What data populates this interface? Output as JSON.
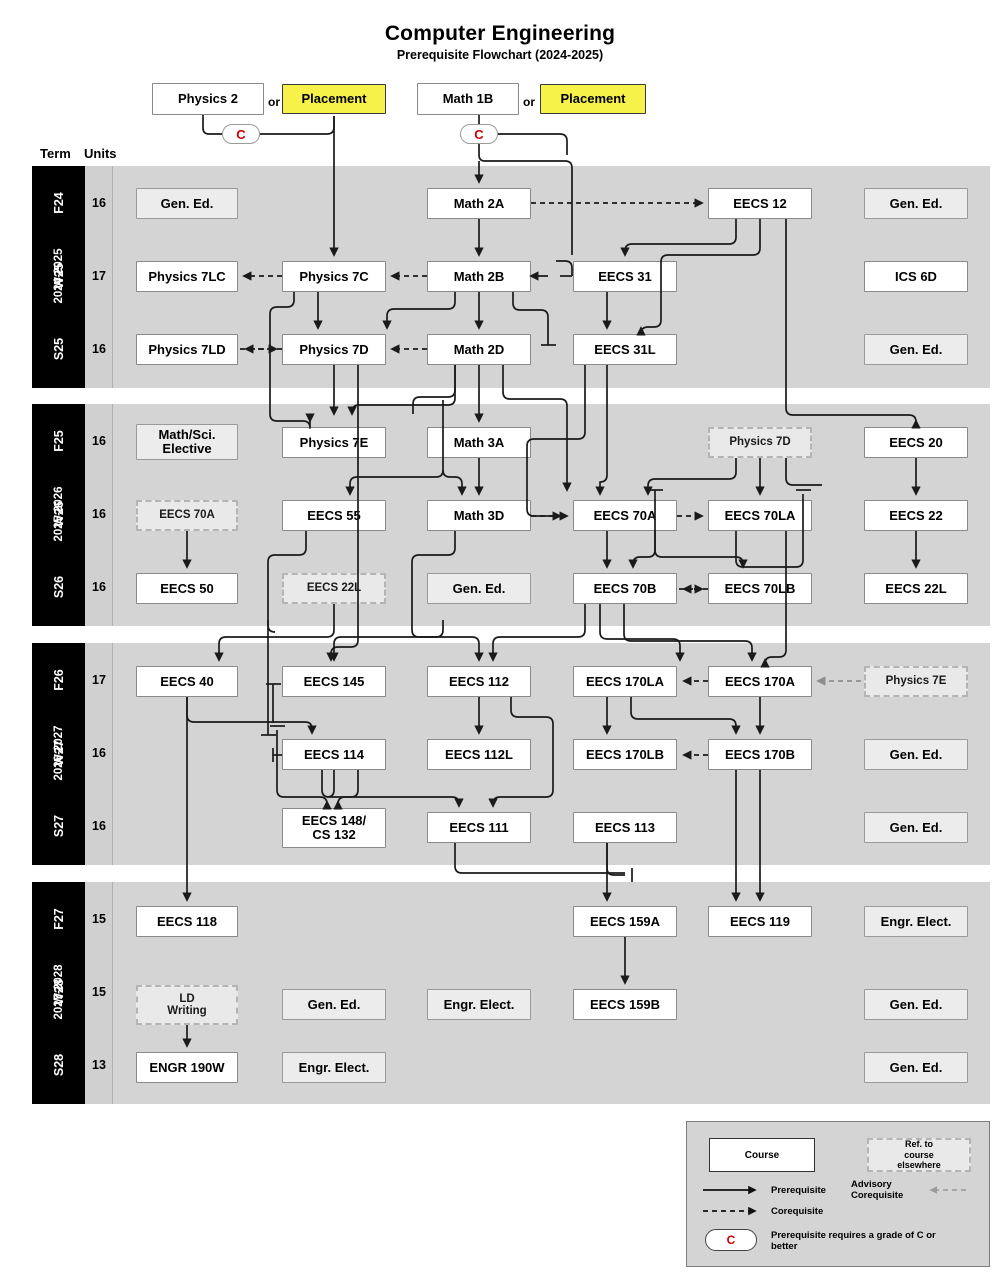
{
  "header": {
    "title": "Computer Engineering",
    "subtitle": "Prerequisite Flowchart (2024-2025)",
    "term_label": "Term",
    "units_label": "Units"
  },
  "entry_row": {
    "physics_2": "Physics 2",
    "or_1": "or",
    "placement_1": "Placement",
    "math_1b": "Math 1B",
    "or_2": "or",
    "placement_2": "Placement",
    "grade_badge_1": "C",
    "grade_badge_2": "C"
  },
  "years": [
    {
      "year_label": "2024-2025",
      "terms": [
        {
          "term": "F24",
          "units": "16",
          "courses": [
            "Gen. Ed.",
            "",
            "Math 2A",
            "",
            "EECS 12",
            "Gen. Ed."
          ]
        },
        {
          "term": "W25",
          "units": "17",
          "courses": [
            "Physics 7LC",
            "Physics 7C",
            "Math 2B",
            "EECS 31",
            "",
            "ICS 6D"
          ]
        },
        {
          "term": "S25",
          "units": "16",
          "courses": [
            "Physics 7LD",
            "Physics 7D",
            "Math 2D",
            "EECS 31L",
            "",
            "Gen. Ed."
          ]
        }
      ]
    },
    {
      "year_label": "2025-2026",
      "terms": [
        {
          "term": "F25",
          "units": "16",
          "courses": [
            "Math/Sci. Elective",
            "Physics 7E",
            "Math 3A",
            "",
            "Physics 7D",
            "EECS 20"
          ]
        },
        {
          "term": "W26",
          "units": "16",
          "courses": [
            "EECS 70A",
            "EECS 55",
            "Math 3D",
            "EECS 70A",
            "EECS 70LA",
            "EECS 22"
          ]
        },
        {
          "term": "S26",
          "units": "16",
          "courses": [
            "EECS 50",
            "EECS 22L",
            "Gen. Ed.",
            "EECS 70B",
            "EECS 70LB",
            "EECS 22L"
          ]
        }
      ]
    },
    {
      "year_label": "2026-2027",
      "terms": [
        {
          "term": "F26",
          "units": "17",
          "courses": [
            "EECS 40",
            "EECS 145",
            "EECS 112",
            "EECS 170LA",
            "EECS 170A",
            "Physics 7E"
          ]
        },
        {
          "term": "W27",
          "units": "16",
          "courses": [
            "",
            "EECS 114",
            "EECS 112L",
            "EECS 170LB",
            "EECS 170B",
            "Gen. Ed."
          ]
        },
        {
          "term": "S27",
          "units": "16",
          "courses": [
            "",
            "EECS 148/ CS 132",
            "EECS 111",
            "EECS 113",
            "",
            "Gen. Ed."
          ]
        }
      ]
    },
    {
      "year_label": "2027-2028",
      "terms": [
        {
          "term": "F27",
          "units": "15",
          "courses": [
            "EECS 118",
            "",
            "",
            "EECS 159A",
            "EECS 119",
            "Engr. Elect."
          ]
        },
        {
          "term": "W28",
          "units": "15",
          "courses": [
            "LD Writing",
            "Gen. Ed.",
            "Engr. Elect.",
            "EECS 159B",
            "",
            "Gen. Ed."
          ]
        },
        {
          "term": "S28",
          "units": "13",
          "courses": [
            "ENGR 190W",
            "Engr. Elect.",
            "",
            "",
            "",
            "Gen. Ed."
          ]
        }
      ]
    }
  ],
  "boxes": {
    "y1": {
      "c_r1_gened": "Gen. Ed.",
      "c_r1_math2a": "Math 2A",
      "c_r1_eecs12": "EECS 12",
      "c_r1_gened2": "Gen. Ed.",
      "c_r2_phys7lc": "Physics 7LC",
      "c_r2_phys7c": "Physics 7C",
      "c_r2_math2b": "Math 2B",
      "c_r2_eecs31": "EECS 31",
      "c_r2_ics6d": "ICS 6D",
      "c_r3_phys7ld": "Physics 7LD",
      "c_r3_phys7d": "Physics 7D",
      "c_r3_math2d": "Math 2D",
      "c_r3_eecs31l": "EECS 31L",
      "c_r3_gened": "Gen. Ed."
    },
    "y2": {
      "c_r1_mathsci_l1": "Math/Sci.",
      "c_r1_mathsci_l2": "Elective",
      "c_r1_phys7e": "Physics 7E",
      "c_r1_math3a": "Math 3A",
      "c_r1_phys7d_ref": "Physics 7D",
      "c_r1_eecs20": "EECS 20",
      "c_r2_eecs70a_ref": "EECS 70A",
      "c_r2_eecs55": "EECS 55",
      "c_r2_math3d": "Math 3D",
      "c_r2_eecs70a": "EECS 70A",
      "c_r2_eecs70la": "EECS 70LA",
      "c_r2_eecs22": "EECS 22",
      "c_r3_eecs50": "EECS 50",
      "c_r3_eecs22l_ref": "EECS 22L",
      "c_r3_gened": "Gen. Ed.",
      "c_r3_eecs70b": "EECS 70B",
      "c_r3_eecs70lb": "EECS 70LB",
      "c_r3_eecs22l": "EECS 22L"
    },
    "y3": {
      "c_r1_eecs40": "EECS 40",
      "c_r1_eecs145": "EECS 145",
      "c_r1_eecs112": "EECS 112",
      "c_r1_eecs170la": "EECS 170LA",
      "c_r1_eecs170a": "EECS 170A",
      "c_r1_phys7e_ref": "Physics 7E",
      "c_r2_eecs114": "EECS 114",
      "c_r2_eecs112l": "EECS 112L",
      "c_r2_eecs170lb": "EECS 170LB",
      "c_r2_eecs170b": "EECS 170B",
      "c_r2_gened": "Gen. Ed.",
      "c_r3_eecs148_l1": "EECS 148/",
      "c_r3_eecs148_l2": "CS 132",
      "c_r3_eecs111": "EECS 111",
      "c_r3_eecs113": "EECS 113",
      "c_r3_gened": "Gen. Ed."
    },
    "y4": {
      "c_r1_eecs118": "EECS 118",
      "c_r1_eecs159a": "EECS 159A",
      "c_r1_eecs119": "EECS 119",
      "c_r1_engrelect": "Engr. Elect.",
      "c_r2_ldwriting_l1": "LD",
      "c_r2_ldwriting_l2": "Writing",
      "c_r2_gened": "Gen. Ed.",
      "c_r2_engrelect": "Engr. Elect.",
      "c_r2_eecs159b": "EECS 159B",
      "c_r2_gened2": "Gen. Ed.",
      "c_r3_engr190w": "ENGR 190W",
      "c_r3_engrelect": "Engr. Elect.",
      "c_r3_gened": "Gen. Ed."
    }
  },
  "legend": {
    "course": "Course",
    "ref_elsewhere_l1": "Ref. to",
    "ref_elsewhere_l2": "course",
    "ref_elsewhere_l3": "elsewhere",
    "prerequisite": "Prerequisite",
    "corequisite": "Corequisite",
    "advisory_l1": "Advisory",
    "advisory_l2": "Corequisite",
    "grade_c": "C",
    "grade_note_l1": "Prerequisite requires a grade of C or",
    "grade_note_l2": "better"
  },
  "colors": {
    "panel_bg": "#d4d4d4",
    "term_bar": "#000000",
    "placement_yellow": "#f7f24a",
    "grade_red": "#cc0000",
    "gened_fill": "#ececec",
    "ref_border": "#b4b4b4"
  }
}
